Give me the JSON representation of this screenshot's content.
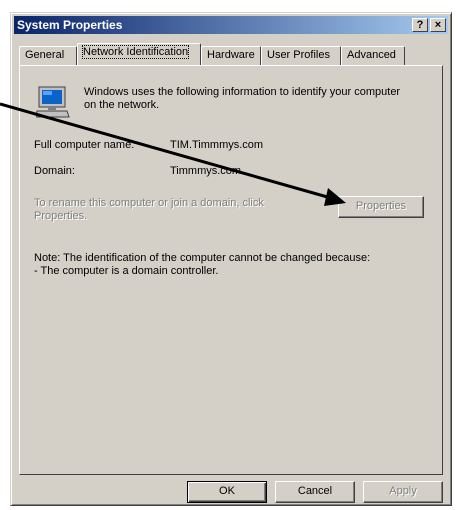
{
  "window": {
    "title": "System Properties",
    "help_button": "?",
    "close_button": "×"
  },
  "tabs": [
    {
      "label": "General",
      "active": false
    },
    {
      "label": "Network Identification",
      "active": true
    },
    {
      "label": "Hardware",
      "active": false
    },
    {
      "label": "User Profiles",
      "active": false
    },
    {
      "label": "Advanced",
      "active": false
    }
  ],
  "panel": {
    "intro_line1": "Windows uses the following information to identify your computer",
    "intro_line2": "on the network.",
    "full_name_label": "Full computer name:",
    "full_name_value": "TIM.Timmmys.com",
    "domain_label": "Domain:",
    "domain_value": "Timmmys.com",
    "rename_line1": "To rename this computer or join a domain, click",
    "rename_line2": "Properties.",
    "properties_button": "Properties",
    "note_line1": "Note: The identification of the computer cannot be changed because:",
    "note_line2": "- The computer is a domain controller."
  },
  "buttons": {
    "ok": "OK",
    "cancel": "Cancel",
    "apply": "Apply"
  },
  "annotations": {
    "arrow_color": "#000000"
  },
  "colors": {
    "titlebar_start": "#0a246a",
    "titlebar_end": "#a6caf0",
    "face": "#d4d0c8"
  }
}
